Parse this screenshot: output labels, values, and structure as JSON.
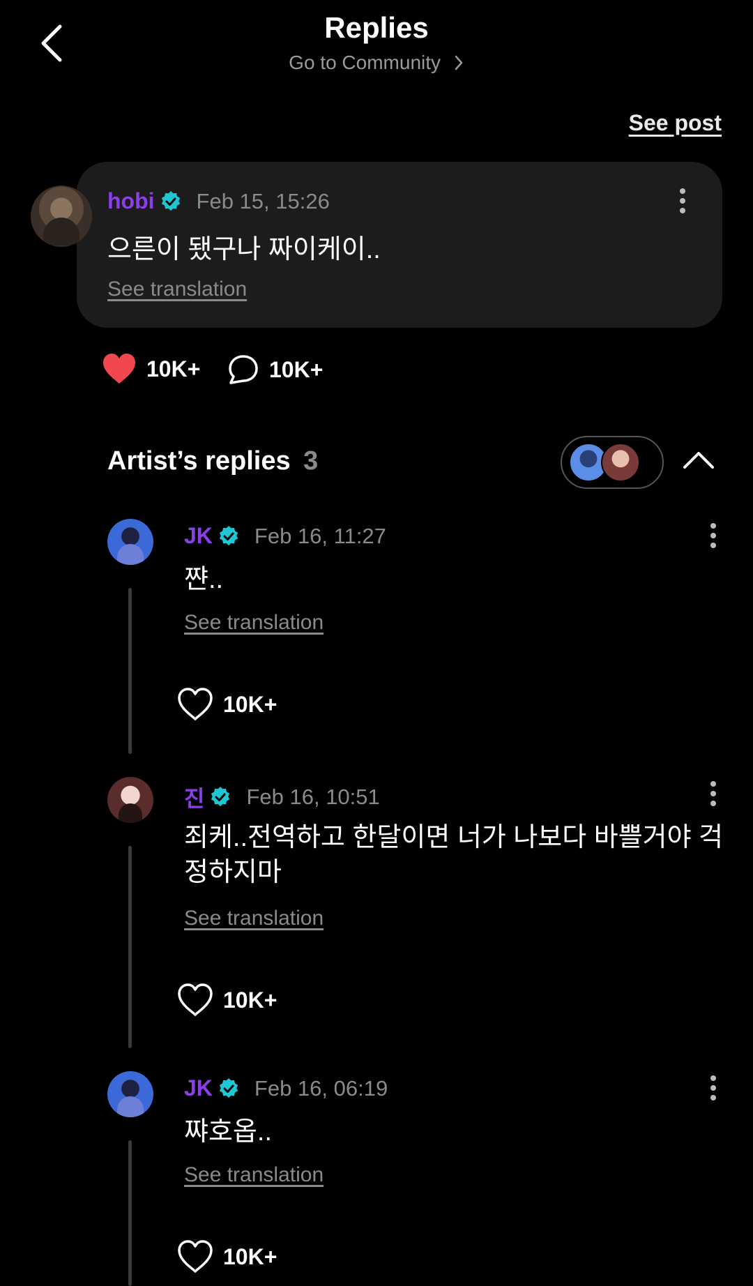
{
  "header": {
    "title": "Replies",
    "community_link": "Go to Community"
  },
  "see_post": "See post",
  "post": {
    "author": "hobi",
    "timestamp": "Feb 15, 15:26",
    "text": "으른이 됐구나 짜이케이..",
    "see_translation": "See translation",
    "likes": "10K+",
    "comments": "10K+"
  },
  "artist_replies": {
    "heading": "Artist’s replies",
    "count": "3",
    "items": [
      {
        "author": "JK",
        "timestamp": "Feb 16, 11:27",
        "text": "쨘..",
        "see_translation": "See translation",
        "likes": "10K+"
      },
      {
        "author": "진",
        "timestamp": "Feb 16, 10:51",
        "text": "죄케..전역하고 한달이면 너가 나보다 바쁠거야 걱정하지마",
        "see_translation": "See translation",
        "likes": "10K+"
      },
      {
        "author": "JK",
        "timestamp": "Feb 16, 06:19",
        "text": "쨔호옵..",
        "see_translation": "See translation",
        "likes": "10K+"
      }
    ]
  },
  "colors": {
    "background": "#000000",
    "card": "#1c1c1c",
    "author_name": "#8b3fe8",
    "verified": "#1fc7d4",
    "like_active": "#f2474f",
    "muted_text": "#8a8a8a"
  },
  "icons": {
    "back": "chevron-left-icon",
    "verified": "verified-badge-icon",
    "more": "more-vertical-icon",
    "like_filled": "heart-filled-icon",
    "like_outline": "heart-outline-icon",
    "comment": "comment-bubble-icon",
    "collapse": "chevron-up-icon"
  }
}
